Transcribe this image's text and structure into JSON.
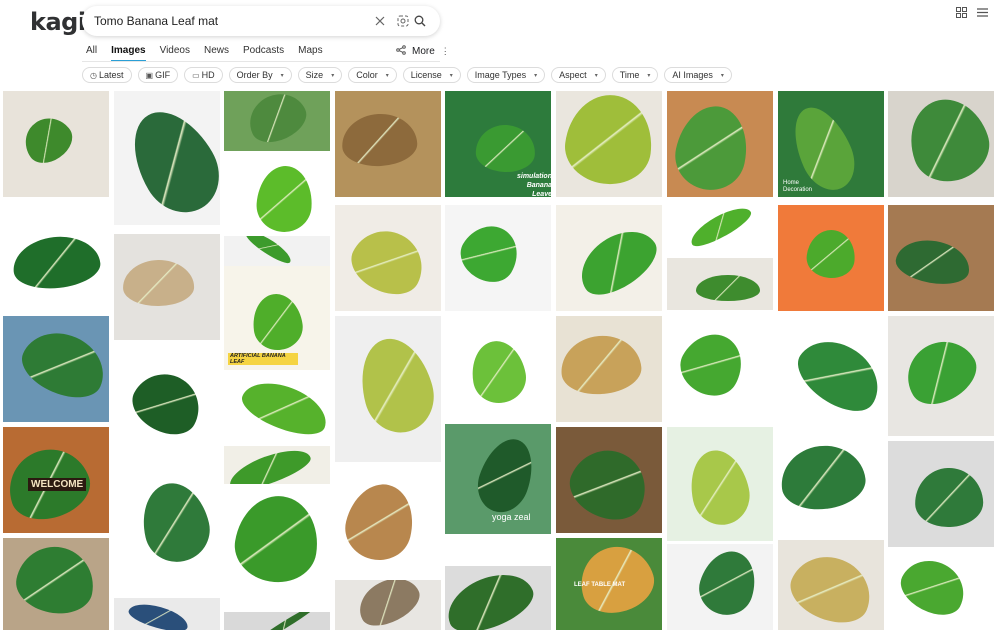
{
  "logo": "kagi",
  "search": {
    "value": "Tomo Banana Leaf mat"
  },
  "tabs": [
    {
      "label": "All",
      "active": false
    },
    {
      "label": "Images",
      "active": true
    },
    {
      "label": "Videos",
      "active": false
    },
    {
      "label": "News",
      "active": false
    },
    {
      "label": "Podcasts",
      "active": false
    },
    {
      "label": "Maps",
      "active": false
    }
  ],
  "more_label": "More",
  "filters": [
    {
      "label": "Latest",
      "icon": "clock-icon",
      "dropdown": false
    },
    {
      "label": "GIF",
      "icon": "gif-icon",
      "dropdown": false
    },
    {
      "label": "HD",
      "icon": "hd-icon",
      "dropdown": false
    },
    {
      "label": "Order By",
      "icon": "",
      "dropdown": true
    },
    {
      "label": "Size",
      "icon": "",
      "dropdown": true
    },
    {
      "label": "Color",
      "icon": "",
      "dropdown": true
    },
    {
      "label": "License",
      "icon": "",
      "dropdown": true
    },
    {
      "label": "Image Types",
      "icon": "",
      "dropdown": true
    },
    {
      "label": "Aspect",
      "icon": "",
      "dropdown": true
    },
    {
      "label": "Time",
      "icon": "",
      "dropdown": true
    },
    {
      "label": "AI Images",
      "icon": "",
      "dropdown": true
    }
  ],
  "captions": {
    "banana_leave": "simulation Banana Leave",
    "yoga_zeal": "yoga zeal",
    "welcome": "WELCOME",
    "artificial": "ARTIFICIAL BANANA LEAF",
    "leaf_table_mat": "LEAF TABLE MAT",
    "home_deco": "Home Decoration"
  },
  "colors": {
    "accent": "#2a9fd6",
    "leaf_dark": "#1f6e2a",
    "leaf_mid": "#3d9a2e",
    "leaf_light": "#7cc04a"
  }
}
